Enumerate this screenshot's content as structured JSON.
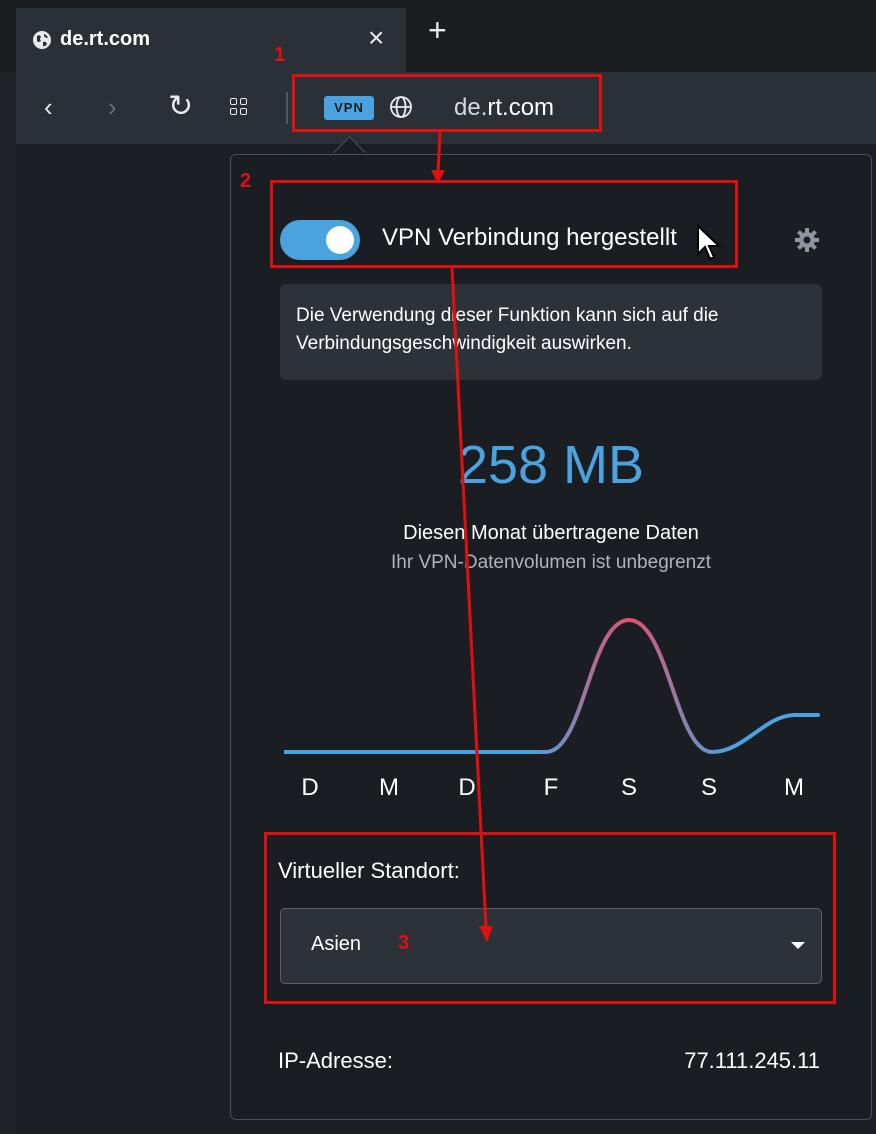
{
  "browser": {
    "tab_title": "de.rt.com",
    "close_glyph": "×",
    "newtab_glyph": "+",
    "back_glyph": "‹",
    "forward_glyph": "›",
    "reload_glyph": "↻",
    "vpn_badge": "VPN",
    "url_host_prefix": "de.",
    "url_host_domain": "rt.com"
  },
  "popup": {
    "vpn_status": "VPN Verbindung hergestellt",
    "toggle_on": true,
    "notice": "Die Verwendung dieser Funktion kann sich auf die Verbindungsgeschwindigkeit auswirken.",
    "amount": "258 MB",
    "month_label": "Diesen Monat übertragene Daten",
    "unlimited_label": "Ihr VPN-Datenvolumen ist unbegrenzt",
    "days": [
      "D",
      "M",
      "D",
      "F",
      "S",
      "S",
      "M"
    ],
    "location_label": "Virtueller Standort:",
    "location_value": "Asien",
    "ip_label": "IP-Adresse:",
    "ip_value": "77.111.245.11"
  },
  "annotations": [
    "1",
    "2",
    "3"
  ],
  "colors": {
    "accent": "#4aa3df",
    "annotation": "#e01010",
    "chart_peak": "#e2506c"
  },
  "icons": [
    "globe-icon",
    "close-icon",
    "plus-icon",
    "back-icon",
    "forward-icon",
    "reload-icon",
    "grid-icon",
    "gear-icon",
    "chevron-down-icon",
    "cursor-icon"
  ]
}
